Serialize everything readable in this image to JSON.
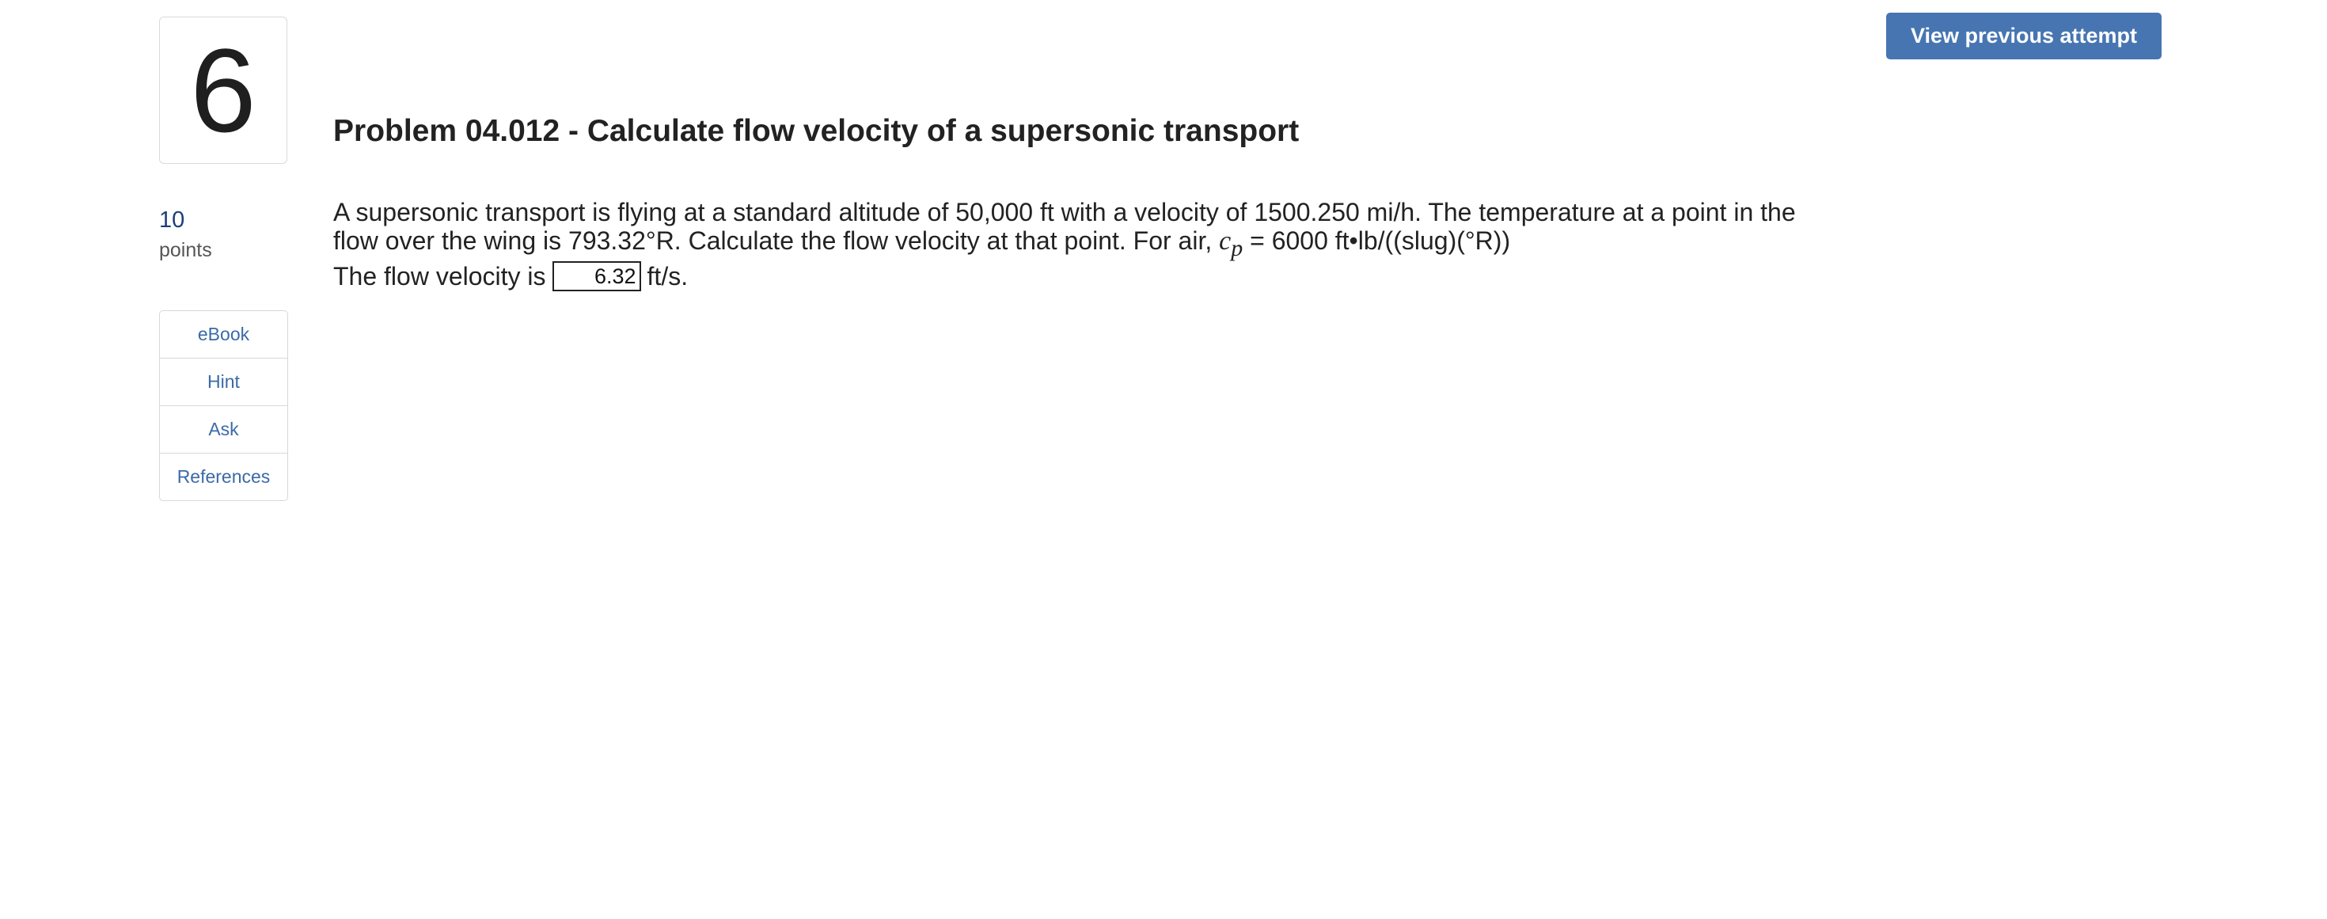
{
  "question": {
    "number": "6",
    "points_value": "10",
    "points_label": "points",
    "title": "Problem 04.012 - Calculate flow velocity of a supersonic transport",
    "text_part1": "A supersonic transport is flying at a standard altitude of 50,000 ft with a velocity of 1500.250 mi/h. The temperature at a point in the flow over the wing is 793.32°R. Calculate the flow velocity at that point. For air, ",
    "cp_symbol": "c",
    "cp_subscript": "p",
    "text_part2": " = 6000 ft•lb/((slug)(°R))",
    "answer_prefix": "The flow velocity is",
    "answer_value": "6.32",
    "answer_unit": "ft/s."
  },
  "tools": {
    "items": [
      {
        "label": "eBook"
      },
      {
        "label": "Hint"
      },
      {
        "label": "Ask"
      },
      {
        "label": "References"
      }
    ]
  },
  "header": {
    "view_previous_label": "View previous attempt",
    "button_color": "#4675b2"
  }
}
